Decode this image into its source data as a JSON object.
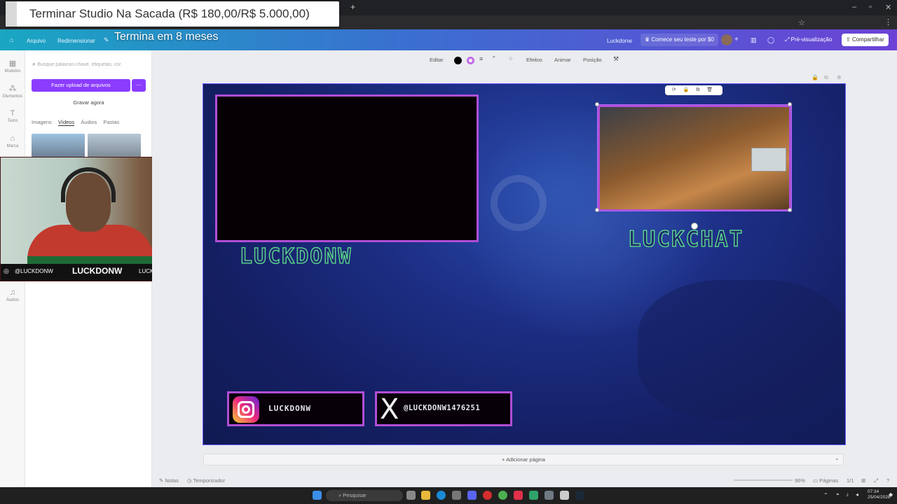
{
  "donation": {
    "text": "Terminar Studio Na Sacada (R$ 180,00/R$ 5.000,00)"
  },
  "countdown": "Termina em 8 meses",
  "header": {
    "arquivo": "Arquivo",
    "redimensionar": "Redimensionar",
    "user": "Luckdonw",
    "trial": "Comece seu teste por $0",
    "preview": "Pré-visualização",
    "share": "Compartilhar"
  },
  "rail": [
    "Modelos",
    "Elementos",
    "Texto",
    "Marca",
    "Áudios"
  ],
  "panel": {
    "search_placeholder": "Busque palavras-chave, etiquetas, cor",
    "upload": "Fazer upload de arquivos",
    "more": "···",
    "record": "Gravar agora",
    "tabs": [
      "Imagens",
      "Vídeos",
      "Áudios",
      "Pastas"
    ],
    "active_tab": "Vídeos"
  },
  "webcam": {
    "ig": "@LUCKDONW",
    "name": "LUCKDONW",
    "yt": "LUCKDONW"
  },
  "toolbar": {
    "edit": "Editar",
    "effects": "Efeitos",
    "animate": "Animar",
    "position": "Posição"
  },
  "canvas": {
    "main_label": "LUCKDONW",
    "chat_label": "LUCKCHAT",
    "instagram": "LUCKDONW",
    "x_handle": "@LUCKDONW1476251",
    "mini_toolbar": "⟳ 🔒 ⧉ 🗑 ···"
  },
  "add_page": "+ Adicionar página",
  "bottom": {
    "notes": "Notas",
    "timer": "Temporizador",
    "zoom": "96%",
    "pages": "Páginas",
    "page_count": "1/1"
  },
  "taskbar": {
    "search": "Pesquisar",
    "time": "07:34",
    "date": "25/04/2026"
  },
  "colors": {
    "purple_border": "#b04ed6",
    "green_text": "#5fe38f",
    "canva_purple": "#8b3dff"
  }
}
